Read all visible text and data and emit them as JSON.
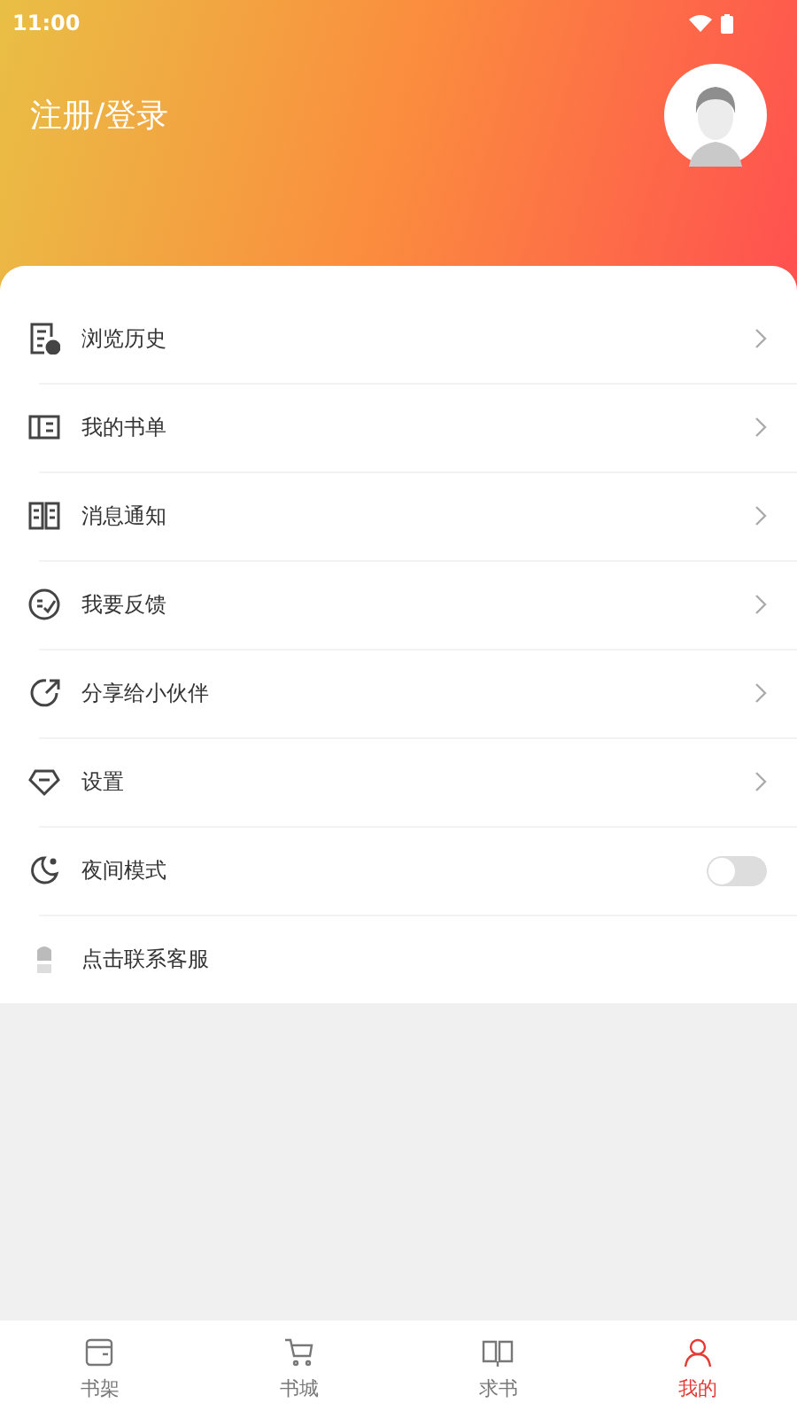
{
  "status_bar": {
    "time": "11:00"
  },
  "header": {
    "login_label": "注册/登录"
  },
  "menu": [
    {
      "label": "浏览历史",
      "kind": "link"
    },
    {
      "label": "我的书单",
      "kind": "link"
    },
    {
      "label": "消息通知",
      "kind": "link"
    },
    {
      "label": "我要反馈",
      "kind": "link"
    },
    {
      "label": "分享给小伙伴",
      "kind": "link"
    },
    {
      "label": "设置",
      "kind": "link"
    },
    {
      "label": "夜间模式",
      "kind": "toggle",
      "on": false
    },
    {
      "label": "点击联系客服",
      "kind": "plain"
    }
  ],
  "tab_bar": [
    {
      "label": "书架",
      "selected": false
    },
    {
      "label": "书城",
      "selected": false
    },
    {
      "label": "求书",
      "selected": false
    },
    {
      "label": "我的",
      "selected": true
    }
  ]
}
